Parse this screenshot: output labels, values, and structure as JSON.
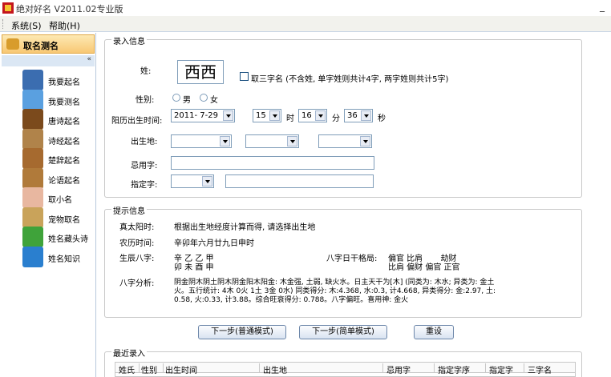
{
  "window": {
    "title": "绝对好名 V2011.02专业版",
    "minimize": "_"
  },
  "menu": [
    "系统(S)",
    "帮助(H)"
  ],
  "sidebar": {
    "header": "取名测名",
    "collapse_glyph": "«",
    "items": [
      {
        "label": "我要起名",
        "icon": "person-icon",
        "color": "#3b6db0"
      },
      {
        "label": "我要测名",
        "icon": "magnifier-icon",
        "color": "#5aa0e0"
      },
      {
        "label": "唐诗起名",
        "icon": "tang-book-icon",
        "color": "#7b4a1c"
      },
      {
        "label": "诗经起名",
        "icon": "scroll-icon",
        "color": "#b0834a"
      },
      {
        "label": "楚辞起名",
        "icon": "scroll-icon",
        "color": "#a66a2f"
      },
      {
        "label": "论语起名",
        "icon": "book-icon",
        "color": "#b07a3a"
      },
      {
        "label": "取小名",
        "icon": "baby-icon",
        "color": "#e8b7a0"
      },
      {
        "label": "宠物取名",
        "icon": "dog-icon",
        "color": "#c9a35a"
      },
      {
        "label": "姓名藏头诗",
        "icon": "poem-icon",
        "color": "#3fa33a"
      },
      {
        "label": "姓名知识",
        "icon": "globe-icon",
        "color": "#2a7fcf"
      }
    ]
  },
  "input_group": {
    "legend": "录入信息",
    "surname_label": "姓:",
    "surname_value": "西西",
    "three_char_label": "取三字名 (不含姓, 单字姓则共计4字, 两字姓则共计5字)",
    "gender_label": "性别:",
    "gender_male": "男",
    "gender_female": "女",
    "birth_label": "阳历出生时间:",
    "birth_date": "2011- 7-29",
    "hour": "15",
    "hour_unit": "时",
    "minute": "16",
    "minute_unit": "分",
    "second": "36",
    "second_unit": "秒",
    "birthplace_label": "出生地:",
    "avoid_label": "忌用字:",
    "specify_label": "指定字:"
  },
  "hint_group": {
    "legend": "提示信息",
    "solar_label": "真太阳时:",
    "solar_value": "根据出生地经度计算而得, 请选择出生地",
    "lunar_label": "农历时间:",
    "lunar_value": "辛卯年六月廿九日申时",
    "bazi_label": "生辰八字:",
    "bazi_top": "辛 乙 乙 甲",
    "bazi_bottom": "卯 未 酉 申",
    "ganzhi_label": "八字日干格局:",
    "ganzhi_top": "偏官 比肩       劫财",
    "ganzhi_bottom": "比肩 偏财 偏官 正官",
    "analysis_label": "八字分析:",
    "analysis_line1": "阴金阴木阴土阴木阴金阳木阳金: 木金强, 土弱, 缺火水。日主天干为[木] (同类为: 木水; 异类为: 金土",
    "analysis_line2": "火。五行统计: 4木 0火 1土 3金 0水) 同类得分: 木:4.368, 水:0.3, 计4.668, 异类得分: 金:2.97, 土:",
    "analysis_line3": "0.58, 火:0.33, 计3.88。综合旺衰得分: 0.788。八字偏旺。喜用神: 金火"
  },
  "buttons": {
    "next_normal": "下一步(普通模式)",
    "next_simple": "下一步(简单模式)",
    "reset": "重设"
  },
  "recent": {
    "legend": "最近录入",
    "columns": [
      "姓氏",
      "性别",
      "出生时间",
      "出生地",
      "忌用字",
      "指定字序",
      "指定字",
      "三字名"
    ]
  },
  "colors": {
    "accent": "#f8c874",
    "border": "#7f9db9"
  }
}
